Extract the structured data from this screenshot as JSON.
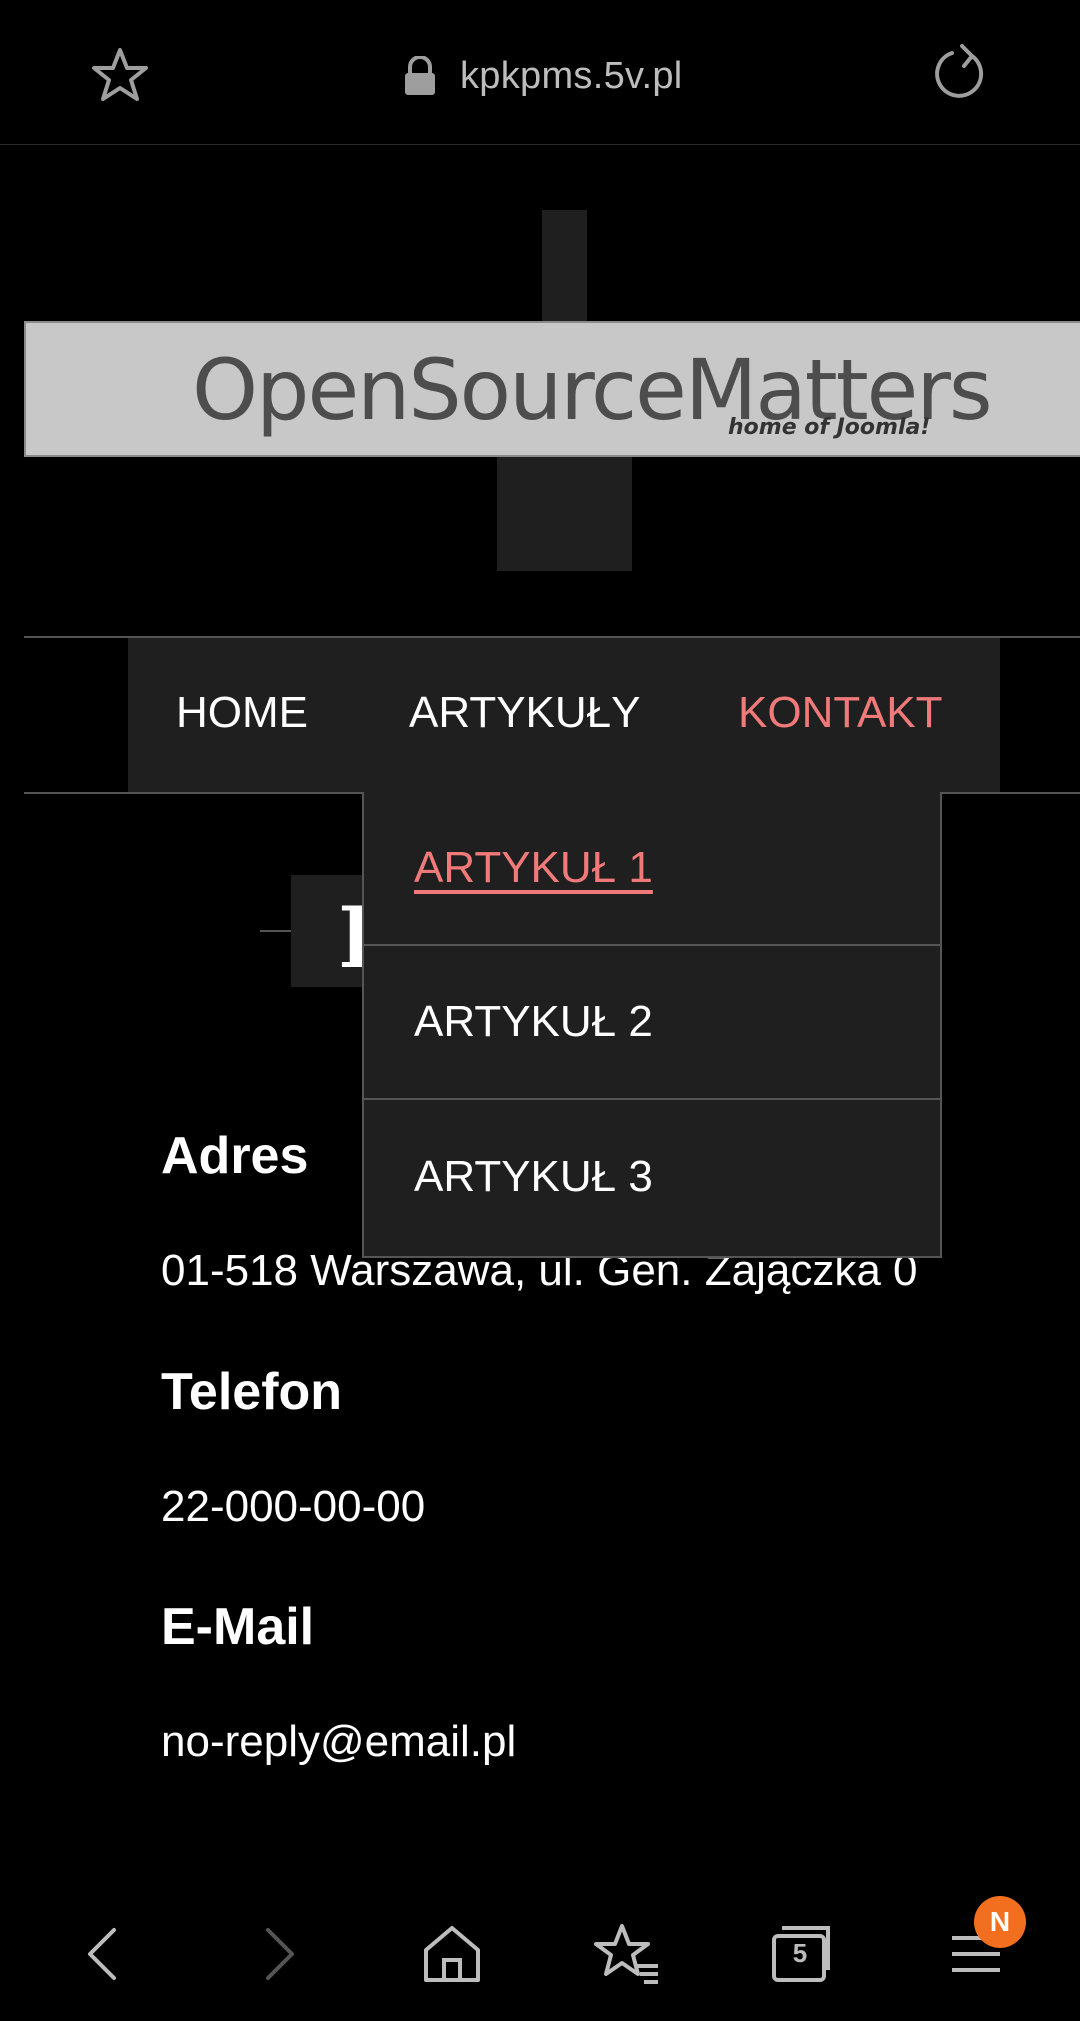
{
  "browser": {
    "url": "kpkpms.5v.pl",
    "tabs_count": "5",
    "menu_badge": "N",
    "icons": [
      "star-icon",
      "lock-icon",
      "reload-icon",
      "back-icon",
      "forward-icon",
      "home-icon",
      "bookmarks-icon",
      "tabs-icon",
      "menu-icon"
    ]
  },
  "header": {
    "logo_main": "OpenSourceMatters",
    "logo_sub": "home of Joomla!"
  },
  "nav": {
    "items": [
      {
        "label": "HOME"
      },
      {
        "label": "ARTYKUŁY"
      },
      {
        "label": "KONTAKT",
        "active": true
      }
    ],
    "active_color": "#f07a7a"
  },
  "dropdown": {
    "items": [
      {
        "label": "ARTYKUŁ 1",
        "hover": true
      },
      {
        "label": "ARTYKUŁ 2"
      },
      {
        "label": "ARTYKUŁ 3"
      }
    ]
  },
  "page": {
    "title_visible": "K"
  },
  "contact": {
    "adres_label": "Adres",
    "adres_value": "01-518 Warszawa, ul. Gen. Zajączka 0",
    "telefon_label": "Telefon",
    "telefon_value": "22-000-00-00",
    "email_label": "E-Mail",
    "email_value": "no-reply@email.pl"
  }
}
